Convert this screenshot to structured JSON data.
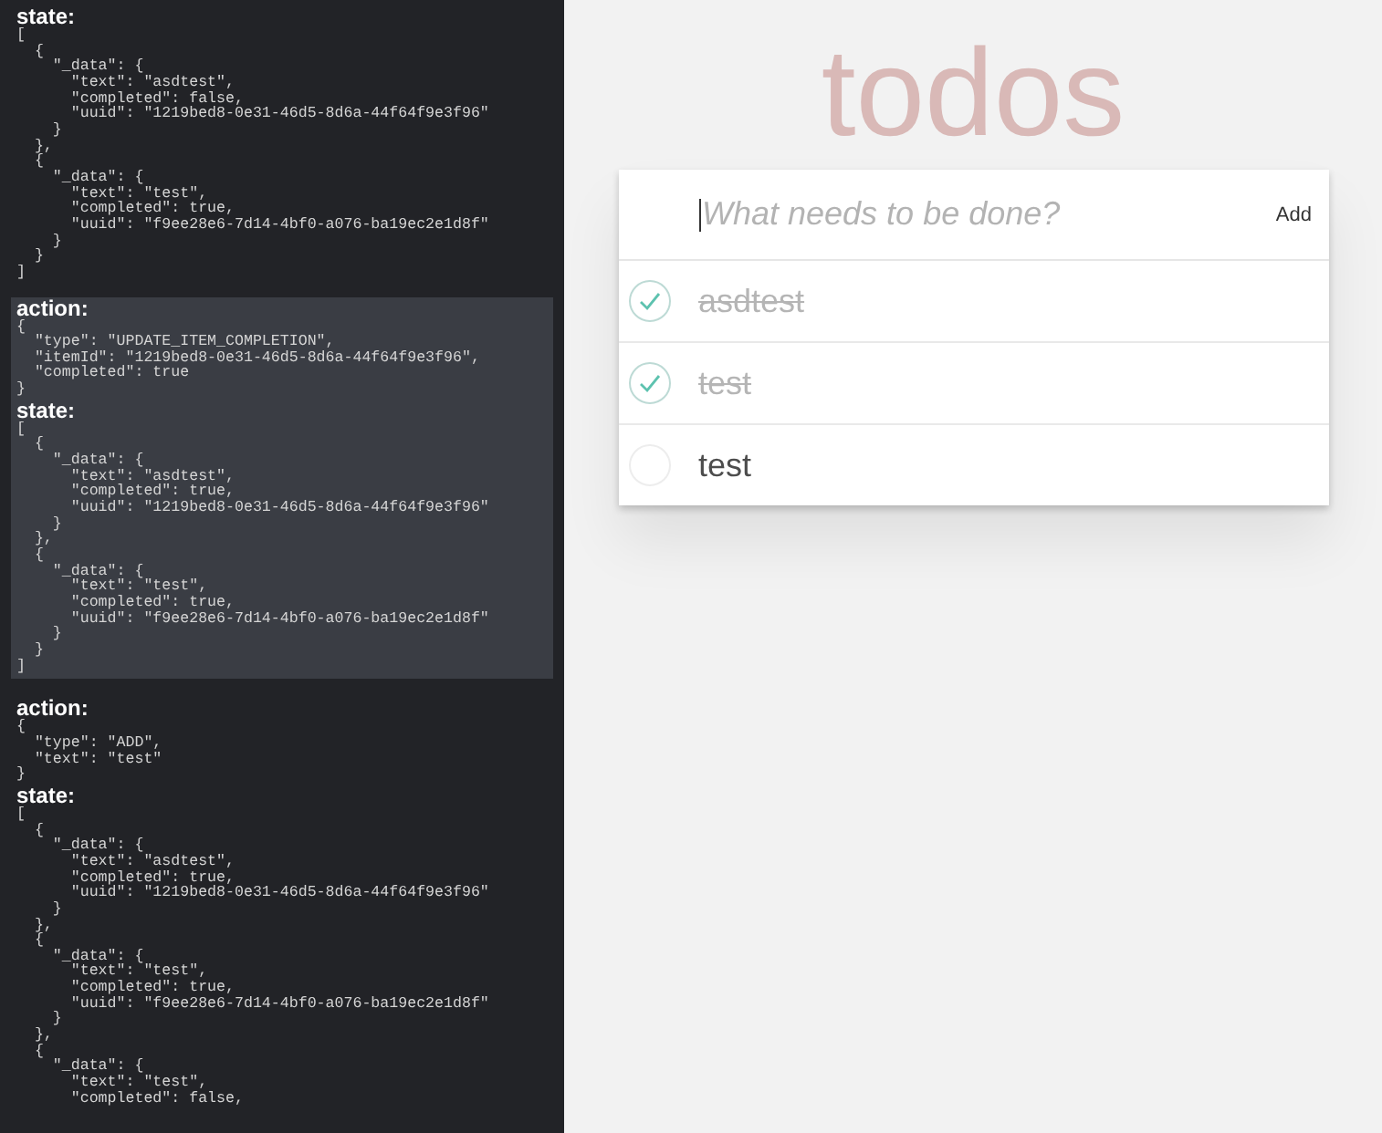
{
  "log": [
    {
      "selected": false,
      "sections": [
        {
          "label": "state:",
          "lines": [
            "[",
            "  {",
            "    \"_data\": {",
            "      \"text\": \"asdtest\",",
            "      \"completed\": false,",
            "      \"uuid\": \"1219bed8-0e31-46d5-8d6a-44f64f9e3f96\"",
            "    }",
            "  },",
            "  {",
            "    \"_data\": {",
            "      \"text\": \"test\",",
            "      \"completed\": true,",
            "      \"uuid\": \"f9ee28e6-7d14-4bf0-a076-ba19ec2e1d8f\"",
            "    }",
            "  }",
            "]"
          ]
        }
      ]
    },
    {
      "selected": true,
      "sections": [
        {
          "label": "action:",
          "lines": [
            "{",
            "  \"type\": \"UPDATE_ITEM_COMPLETION\",",
            "  \"itemId\": \"1219bed8-0e31-46d5-8d6a-44f64f9e3f96\",",
            "  \"completed\": true",
            "}"
          ]
        },
        {
          "label": "state:",
          "lines": [
            "[",
            "  {",
            "    \"_data\": {",
            "      \"text\": \"asdtest\",",
            "      \"completed\": true,",
            "      \"uuid\": \"1219bed8-0e31-46d5-8d6a-44f64f9e3f96\"",
            "    }",
            "  },",
            "  {",
            "    \"_data\": {",
            "      \"text\": \"test\",",
            "      \"completed\": true,",
            "      \"uuid\": \"f9ee28e6-7d14-4bf0-a076-ba19ec2e1d8f\"",
            "    }",
            "  }",
            "]"
          ]
        }
      ]
    },
    {
      "selected": false,
      "sections": [
        {
          "label": "action:",
          "lines": [
            "{",
            "  \"type\": \"ADD\",",
            "  \"text\": \"test\"",
            "}"
          ]
        },
        {
          "label": "state:",
          "lines": [
            "[",
            "  {",
            "    \"_data\": {",
            "      \"text\": \"asdtest\",",
            "      \"completed\": true,",
            "      \"uuid\": \"1219bed8-0e31-46d5-8d6a-44f64f9e3f96\"",
            "    }",
            "  },",
            "  {",
            "    \"_data\": {",
            "      \"text\": \"test\",",
            "      \"completed\": true,",
            "      \"uuid\": \"f9ee28e6-7d14-4bf0-a076-ba19ec2e1d8f\"",
            "    }",
            "  },",
            "  {",
            "    \"_data\": {",
            "      \"text\": \"test\",",
            "      \"completed\": false,"
          ]
        }
      ]
    }
  ],
  "app": {
    "title": "todos",
    "input": {
      "placeholder": "What needs to be done?"
    },
    "add_button": "Add",
    "todos": [
      {
        "text": "asdtest",
        "completed": true
      },
      {
        "text": "test",
        "completed": true
      },
      {
        "text": "test",
        "completed": false
      }
    ]
  }
}
